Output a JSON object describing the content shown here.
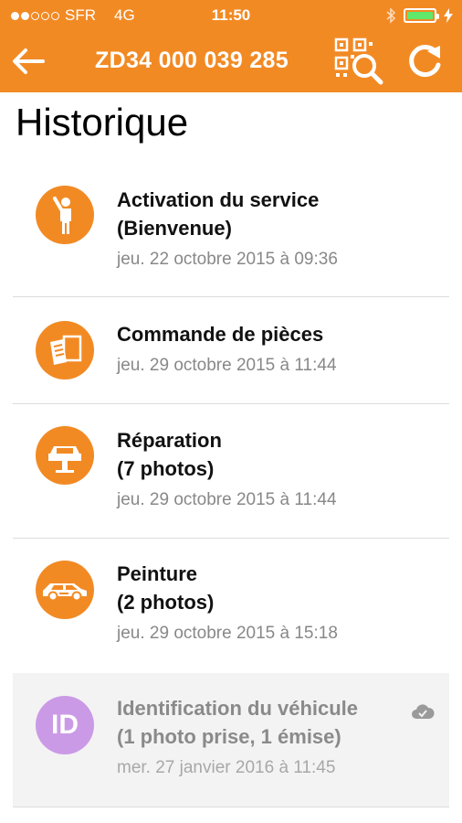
{
  "status_bar": {
    "carrier": "SFR",
    "network": "4G",
    "time": "11:50",
    "signal_dots_filled": 2,
    "signal_dots_total": 5,
    "battery_level": 1.0,
    "icons": [
      "bluetooth-icon",
      "battery-icon",
      "charging-icon"
    ]
  },
  "nav": {
    "title": "ZD34 000 039 285",
    "back_icon": "back-arrow-icon",
    "qr_icon": "qr-search-icon",
    "refresh_icon": "refresh-icon"
  },
  "page": {
    "title": "Historique"
  },
  "history": [
    {
      "title_line1": "Activation du service",
      "title_line2": "(Bienvenue)",
      "date": "jeu. 22 octobre 2015 à 09:36",
      "icon": "person-waving-icon"
    },
    {
      "title_line1": "Commande de pièces",
      "title_line2": "",
      "date": "jeu. 29 octobre 2015 à 11:44",
      "icon": "order-form-icon"
    },
    {
      "title_line1": "Réparation",
      "title_line2": "(7 photos)",
      "date": "jeu. 29 octobre 2015 à 11:44",
      "icon": "car-lift-icon"
    },
    {
      "title_line1": "Peinture",
      "title_line2": "(2 photos)",
      "date": "jeu. 29 octobre 2015 à 15:18",
      "icon": "car-paint-icon"
    },
    {
      "title_line1": "Identification du véhicule",
      "title_line2": "(1 photo prise, 1 émise)",
      "date": "mer. 27 janvier 2016 à 11:45",
      "icon": "cloud-check-icon",
      "avatar_text": "ID"
    }
  ],
  "colors": {
    "accent": "#f28a24",
    "id_avatar": "#cb9ae6",
    "battery": "#5fe86a"
  }
}
